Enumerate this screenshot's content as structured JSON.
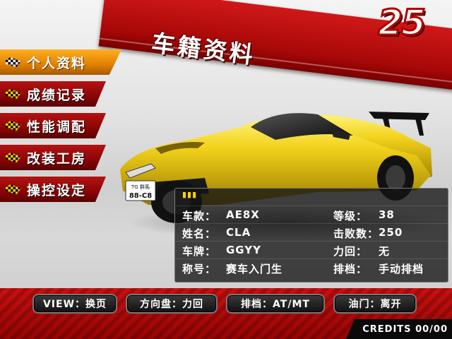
{
  "header": {
    "title": "车籍资料",
    "logo_text": "25"
  },
  "menu": {
    "items": [
      {
        "label": "个人资料",
        "active": true
      },
      {
        "label": "成绩记录",
        "active": false
      },
      {
        "label": "性能调配",
        "active": false
      },
      {
        "label": "改装工房",
        "active": false
      },
      {
        "label": "操控设定",
        "active": false
      }
    ]
  },
  "car": {
    "color": "#f2d21a",
    "plate_top": "TG 群馬",
    "plate_bottom": "88-C8"
  },
  "profile": {
    "rows": [
      {
        "k1": "车款：",
        "v1": "AE8X",
        "k2": "等级：",
        "v2": "38"
      },
      {
        "k1": "姓名：",
        "v1": "CLA",
        "k2": "击败数：",
        "v2": "250"
      },
      {
        "k1": "车牌：",
        "v1": "GGYY",
        "k2": "力回：",
        "v2": "无"
      },
      {
        "k1": "称号：",
        "v1": "赛车入门生",
        "k2": "排档：",
        "v2": "手动排档"
      }
    ]
  },
  "controls": {
    "view": "VIEW：换页",
    "wheel": "方向盘：力回",
    "gear": "排档：AT/MT",
    "throttle": "油门：离开"
  },
  "credits": "CREDITS 00/00",
  "colors": {
    "accent_red": "#b50e0e",
    "menu_active": "#f0a010",
    "checker_yellow": "#ffd200"
  }
}
